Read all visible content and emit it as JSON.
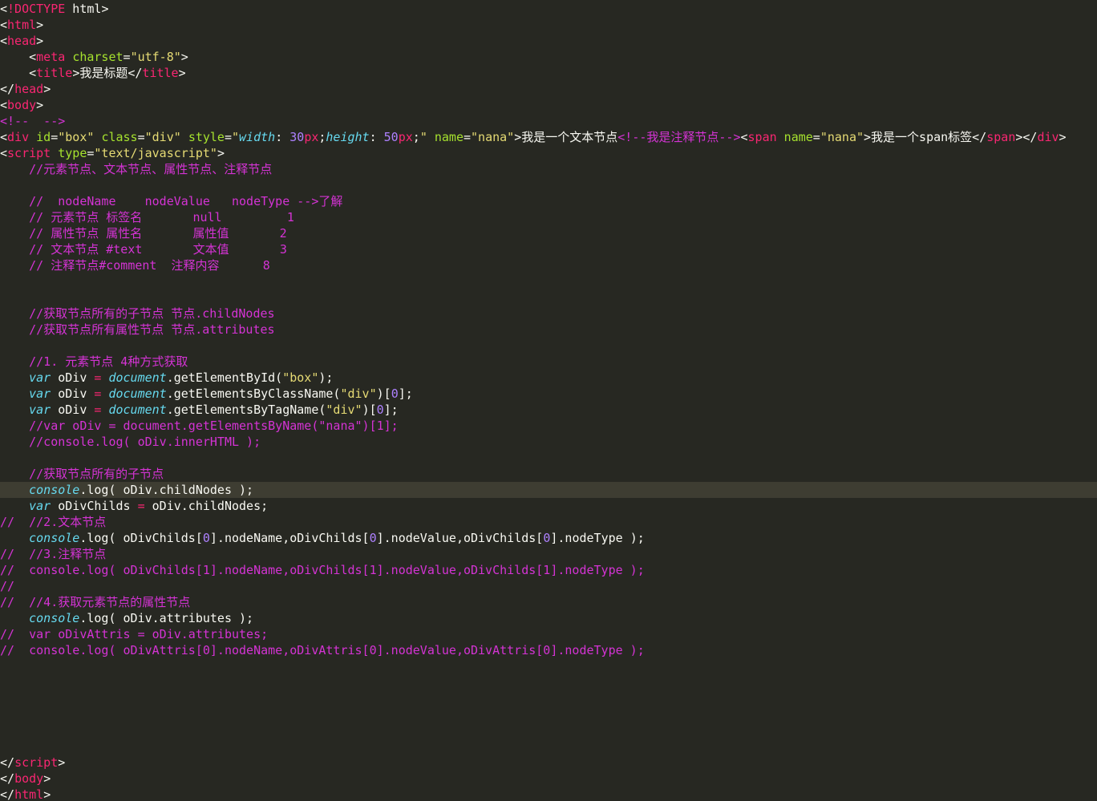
{
  "editor": {
    "theme_colors": {
      "background": "#272822",
      "active_line": "#3e3d32",
      "tag": "#f92672",
      "attribute": "#a6e22e",
      "string": "#e6db74",
      "comment": "#d433d4",
      "keyword": "#66d9ef",
      "number": "#ae81ff",
      "text": "#f8f8f2"
    },
    "active_line_index": 30,
    "lines": [
      [
        [
          "punct",
          "<"
        ],
        [
          "tag",
          "!DOCTYPE"
        ],
        [
          "plain",
          " html"
        ],
        [
          "punct",
          ">"
        ]
      ],
      [
        [
          "punct",
          "<"
        ],
        [
          "tag",
          "html"
        ],
        [
          "punct",
          ">"
        ]
      ],
      [
        [
          "punct",
          "<"
        ],
        [
          "tag",
          "head"
        ],
        [
          "punct",
          ">"
        ]
      ],
      [
        [
          "plain",
          "    "
        ],
        [
          "punct",
          "<"
        ],
        [
          "tag",
          "meta"
        ],
        [
          "plain",
          " "
        ],
        [
          "attr",
          "charset"
        ],
        [
          "punct",
          "="
        ],
        [
          "string",
          "\"utf-8\""
        ],
        [
          "punct",
          ">"
        ]
      ],
      [
        [
          "plain",
          "    "
        ],
        [
          "punct",
          "<"
        ],
        [
          "tag",
          "title"
        ],
        [
          "punct",
          ">"
        ],
        [
          "plain",
          "我是标题"
        ],
        [
          "punct",
          "</"
        ],
        [
          "tag",
          "title"
        ],
        [
          "punct",
          ">"
        ]
      ],
      [
        [
          "punct",
          "</"
        ],
        [
          "tag",
          "head"
        ],
        [
          "punct",
          ">"
        ]
      ],
      [
        [
          "punct",
          "<"
        ],
        [
          "tag",
          "body"
        ],
        [
          "punct",
          ">"
        ]
      ],
      [
        [
          "comment",
          "<!--  -->"
        ]
      ],
      [
        [
          "punct",
          "<"
        ],
        [
          "tag",
          "div"
        ],
        [
          "plain",
          " "
        ],
        [
          "attr",
          "id"
        ],
        [
          "punct",
          "="
        ],
        [
          "string",
          "\"box\""
        ],
        [
          "plain",
          " "
        ],
        [
          "attr",
          "class"
        ],
        [
          "punct",
          "="
        ],
        [
          "string",
          "\"div\""
        ],
        [
          "plain",
          " "
        ],
        [
          "attr",
          "style"
        ],
        [
          "punct",
          "="
        ],
        [
          "string",
          "\""
        ],
        [
          "prop",
          "width"
        ],
        [
          "plain",
          ": "
        ],
        [
          "number",
          "30"
        ],
        [
          "op",
          "px"
        ],
        [
          "plain",
          ";"
        ],
        [
          "prop",
          "height"
        ],
        [
          "plain",
          ": "
        ],
        [
          "number",
          "50"
        ],
        [
          "op",
          "px"
        ],
        [
          "plain",
          ";"
        ],
        [
          "string",
          "\""
        ],
        [
          "plain",
          " "
        ],
        [
          "attr",
          "name"
        ],
        [
          "punct",
          "="
        ],
        [
          "string",
          "\"nana\""
        ],
        [
          "punct",
          ">"
        ],
        [
          "plain",
          "我是一个文本节点"
        ],
        [
          "comment",
          "<!--我是注释节点-->"
        ],
        [
          "punct",
          "<"
        ],
        [
          "tag",
          "span"
        ],
        [
          "plain",
          " "
        ],
        [
          "attr",
          "name"
        ],
        [
          "punct",
          "="
        ],
        [
          "string",
          "\"nana\""
        ],
        [
          "punct",
          ">"
        ],
        [
          "plain",
          "我是一个span标签"
        ],
        [
          "punct",
          "</"
        ],
        [
          "tag",
          "span"
        ],
        [
          "punct",
          "></"
        ],
        [
          "tag",
          "div"
        ],
        [
          "punct",
          ">"
        ]
      ],
      [
        [
          "punct",
          "<"
        ],
        [
          "tag",
          "script"
        ],
        [
          "plain",
          " "
        ],
        [
          "attr",
          "type"
        ],
        [
          "punct",
          "="
        ],
        [
          "string",
          "\"text/javascript\""
        ],
        [
          "punct",
          ">"
        ]
      ],
      [
        [
          "plain",
          "    "
        ],
        [
          "comment",
          "//元素节点、文本节点、属性节点、注释节点"
        ]
      ],
      [],
      [
        [
          "plain",
          "    "
        ],
        [
          "comment",
          "//  nodeName    nodeValue   nodeType -->了解"
        ]
      ],
      [
        [
          "plain",
          "    "
        ],
        [
          "comment",
          "// 元素节点 标签名       null         1"
        ]
      ],
      [
        [
          "plain",
          "    "
        ],
        [
          "comment",
          "// 属性节点 属性名       属性值       2"
        ]
      ],
      [
        [
          "plain",
          "    "
        ],
        [
          "comment",
          "// 文本节点 #text       文本值       3"
        ]
      ],
      [
        [
          "plain",
          "    "
        ],
        [
          "comment",
          "// 注释节点#comment  注释内容      8"
        ]
      ],
      [],
      [],
      [
        [
          "plain",
          "    "
        ],
        [
          "comment",
          "//获取节点所有的子节点 节点.childNodes"
        ]
      ],
      [
        [
          "plain",
          "    "
        ],
        [
          "comment",
          "//获取节点所有属性节点 节点.attributes"
        ]
      ],
      [],
      [
        [
          "plain",
          "    "
        ],
        [
          "comment",
          "//1. 元素节点 4种方式获取"
        ]
      ],
      [
        [
          "plain",
          "    "
        ],
        [
          "keyword",
          "var"
        ],
        [
          "plain",
          " oDiv "
        ],
        [
          "op",
          "="
        ],
        [
          "plain",
          " "
        ],
        [
          "builtin",
          "document"
        ],
        [
          "plain",
          ".getElementById("
        ],
        [
          "string",
          "\"box\""
        ],
        [
          "plain",
          ");"
        ]
      ],
      [
        [
          "plain",
          "    "
        ],
        [
          "keyword",
          "var"
        ],
        [
          "plain",
          " oDiv "
        ],
        [
          "op",
          "="
        ],
        [
          "plain",
          " "
        ],
        [
          "builtin",
          "document"
        ],
        [
          "plain",
          ".getElementsByClassName("
        ],
        [
          "string",
          "\"div\""
        ],
        [
          "plain",
          ")["
        ],
        [
          "number",
          "0"
        ],
        [
          "plain",
          "];"
        ]
      ],
      [
        [
          "plain",
          "    "
        ],
        [
          "keyword",
          "var"
        ],
        [
          "plain",
          " oDiv "
        ],
        [
          "op",
          "="
        ],
        [
          "plain",
          " "
        ],
        [
          "builtin",
          "document"
        ],
        [
          "plain",
          ".getElementsByTagName("
        ],
        [
          "string",
          "\"div\""
        ],
        [
          "plain",
          ")["
        ],
        [
          "number",
          "0"
        ],
        [
          "plain",
          "];"
        ]
      ],
      [
        [
          "plain",
          "    "
        ],
        [
          "comment",
          "//var oDiv = document.getElementsByName(\"nana\")[1];"
        ]
      ],
      [
        [
          "plain",
          "    "
        ],
        [
          "comment",
          "//console.log( oDiv.innerHTML );"
        ]
      ],
      [],
      [
        [
          "plain",
          "    "
        ],
        [
          "comment",
          "//获取节点所有的子节点"
        ]
      ],
      [
        [
          "plain",
          "    "
        ],
        [
          "builtin",
          "console"
        ],
        [
          "plain",
          ".log( oDiv.childNodes );"
        ]
      ],
      [
        [
          "plain",
          "    "
        ],
        [
          "keyword",
          "var"
        ],
        [
          "plain",
          " oDivChilds "
        ],
        [
          "op",
          "="
        ],
        [
          "plain",
          " oDiv.childNodes;"
        ]
      ],
      [
        [
          "comment",
          "//  //2.文本节点"
        ]
      ],
      [
        [
          "plain",
          "    "
        ],
        [
          "builtin",
          "console"
        ],
        [
          "plain",
          ".log( oDivChilds["
        ],
        [
          "number",
          "0"
        ],
        [
          "plain",
          "].nodeName,oDivChilds["
        ],
        [
          "number",
          "0"
        ],
        [
          "plain",
          "].nodeValue,oDivChilds["
        ],
        [
          "number",
          "0"
        ],
        [
          "plain",
          "].nodeType );"
        ]
      ],
      [
        [
          "comment",
          "//  //3.注释节点"
        ]
      ],
      [
        [
          "comment",
          "//  console.log( oDivChilds[1].nodeName,oDivChilds[1].nodeValue,oDivChilds[1].nodeType );"
        ]
      ],
      [
        [
          "comment",
          "//"
        ]
      ],
      [
        [
          "comment",
          "//  //4.获取元素节点的属性节点"
        ]
      ],
      [
        [
          "plain",
          "    "
        ],
        [
          "builtin",
          "console"
        ],
        [
          "plain",
          ".log( oDiv.attributes );"
        ]
      ],
      [
        [
          "comment",
          "//  var oDivAttris = oDiv.attributes;"
        ]
      ],
      [
        [
          "comment",
          "//  console.log( oDivAttris[0].nodeName,oDivAttris[0].nodeValue,oDivAttris[0].nodeType );"
        ]
      ],
      [],
      [],
      [],
      [],
      [],
      [],
      [
        [
          "punct",
          "</"
        ],
        [
          "tag",
          "script"
        ],
        [
          "punct",
          ">"
        ]
      ],
      [
        [
          "punct",
          "</"
        ],
        [
          "tag",
          "body"
        ],
        [
          "punct",
          ">"
        ]
      ],
      [
        [
          "punct",
          "</"
        ],
        [
          "tag",
          "html"
        ],
        [
          "punct",
          ">"
        ]
      ]
    ]
  }
}
